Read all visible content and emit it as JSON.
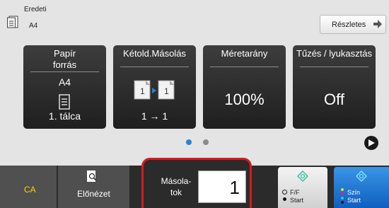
{
  "header": {
    "original_title": "Eredeti",
    "original_value": "A4",
    "details_label": "Részletes"
  },
  "tiles": [
    {
      "title": "Papír\nforrás",
      "value": "A4",
      "sub": "1. tálca",
      "icon": "paper-tray-icon"
    },
    {
      "title": "Kétold.Másolás",
      "sub": "1 → 1",
      "icon": "duplex-copy-icon"
    },
    {
      "title": "Méretarány",
      "value": "100%"
    },
    {
      "title": "Tűzés / lyukasztás",
      "value": "Off"
    }
  ],
  "pagination": {
    "current": 1,
    "total": 2
  },
  "bottom": {
    "ca_label": "CA",
    "preview_label": "Előnézet",
    "copies_label": "Másola-\ntok",
    "copies_value": "1",
    "bw_start_line1": "F/F",
    "bw_start_line2": "Start",
    "color_start_line1": "Szín",
    "color_start_line2": "Start"
  },
  "colors": {
    "accent_blue": "#2a82d8",
    "highlight_red": "#d7191f",
    "ca_yellow": "#ffd100"
  }
}
